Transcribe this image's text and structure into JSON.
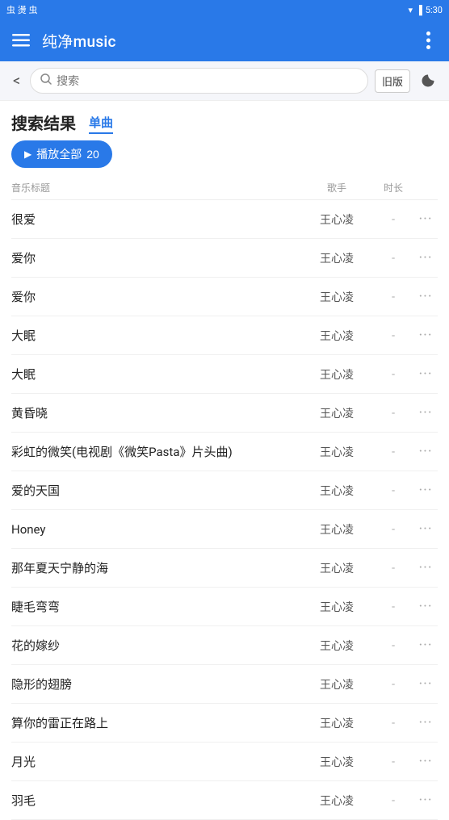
{
  "statusBar": {
    "leftText": "虫 燙 虫",
    "time": "5:30",
    "icons": [
      "wifi",
      "signal",
      "battery"
    ]
  },
  "topBar": {
    "menuIcon": "≡",
    "title": "纯净music",
    "moreIcon": "⋮"
  },
  "searchBar": {
    "backIcon": "<",
    "searchIcon": "🔍",
    "placeholder": "搜索",
    "oldVersionLabel": "旧版",
    "darkModeIcon": "🌙"
  },
  "resultSection": {
    "title": "搜索结果",
    "tab": "单曲",
    "playAllLabel": "播放全部",
    "playAllCount": "20"
  },
  "tableHeader": {
    "titleCol": "音乐标题",
    "artistCol": "歌手",
    "durationCol": "时长"
  },
  "songs": [
    {
      "name": "很爱",
      "artist": "王心凌",
      "duration": "-"
    },
    {
      "name": "爱你",
      "artist": "王心凌",
      "duration": "-"
    },
    {
      "name": "爱你",
      "artist": "王心凌",
      "duration": "-"
    },
    {
      "name": "大眠",
      "artist": "王心凌",
      "duration": "-"
    },
    {
      "name": "大眠",
      "artist": "王心凌",
      "duration": "-"
    },
    {
      "name": "黄昏晓",
      "artist": "王心凌",
      "duration": "-"
    },
    {
      "name": "彩虹的微笑(电视剧《微笑Pasta》片头曲)",
      "artist": "王心凌",
      "duration": "-"
    },
    {
      "name": "爱的天国",
      "artist": "王心凌",
      "duration": "-"
    },
    {
      "name": "Honey",
      "artist": "王心凌",
      "duration": "-"
    },
    {
      "name": "那年夏天宁静的海",
      "artist": "王心凌",
      "duration": "-"
    },
    {
      "name": "睫毛弯弯",
      "artist": "王心凌",
      "duration": "-"
    },
    {
      "name": "花的嫁纱",
      "artist": "王心凌",
      "duration": "-"
    },
    {
      "name": "隐形的翅膀",
      "artist": "王心凌",
      "duration": "-"
    },
    {
      "name": "算你的雷正在路上",
      "artist": "王心凌",
      "duration": "-"
    },
    {
      "name": "月光",
      "artist": "王心凌",
      "duration": "-"
    },
    {
      "name": "羽毛",
      "artist": "王心凌",
      "duration": "-"
    }
  ],
  "moreIcon": "···"
}
